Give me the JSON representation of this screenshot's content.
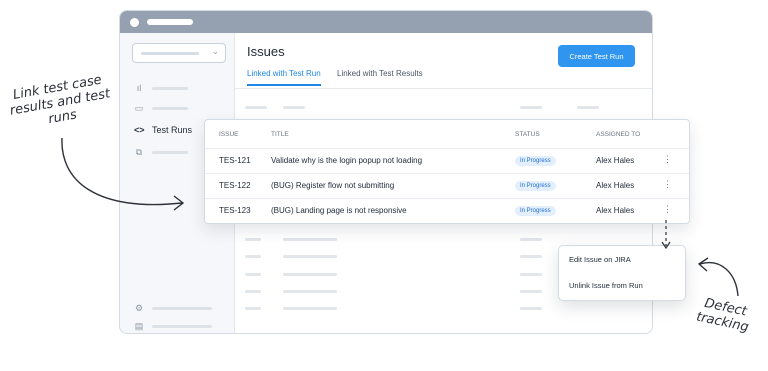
{
  "annotations": {
    "left_note": "Link test case results and test runs",
    "right_note": "Defect tracking"
  },
  "sidebar": {
    "active_label": "Test Runs",
    "active_icon": "code-brackets-icon"
  },
  "main": {
    "title": "Issues",
    "tabs": [
      "Linked with Test Run",
      "Linked with Test Results"
    ],
    "create_button": "Create Test Run"
  },
  "issues_table": {
    "headers": [
      "ISSUE",
      "TITLE",
      "STATUS",
      "ASSIGNED TO"
    ],
    "rows": [
      {
        "issue": "TES-121",
        "title": "Validate why is the login popup not loading",
        "status": "In Progress",
        "assigned": "Alex Hales"
      },
      {
        "issue": "TES-122",
        "title": "(BUG) Register flow not submitting",
        "status": "In Progress",
        "assigned": "Alex Hales"
      },
      {
        "issue": "TES-123",
        "title": "(BUG) Landing page is not responsive",
        "status": "In Progress",
        "assigned": "Alex Hales"
      }
    ]
  },
  "context_menu": {
    "items": [
      "Edit Issue on JIRA",
      "Unlink Issue from Run"
    ]
  },
  "colors": {
    "accent": "#2f95ef",
    "titlebar": "#95a1b0",
    "badge_bg": "#e3effd"
  }
}
